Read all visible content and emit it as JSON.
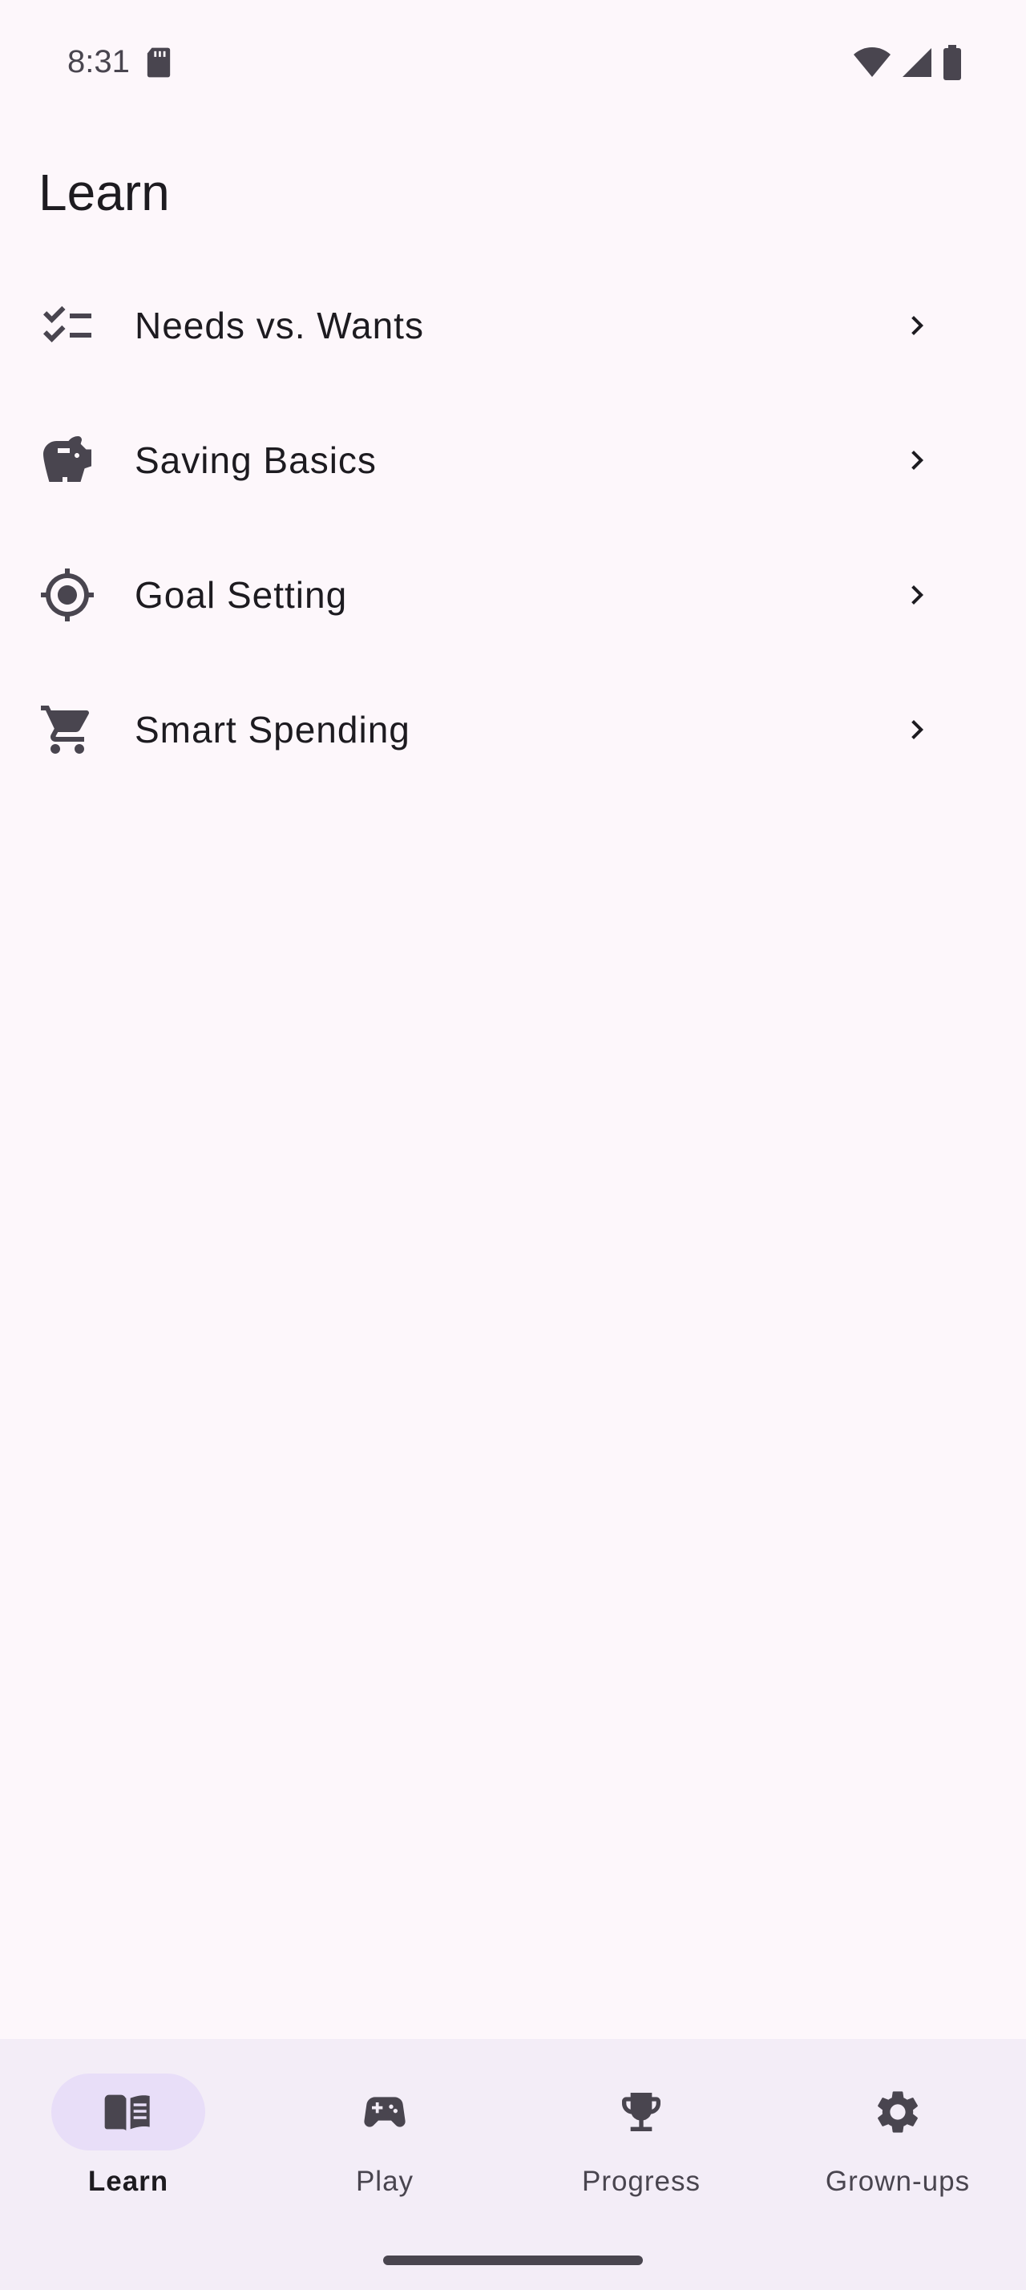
{
  "status_bar": {
    "time": "8:31",
    "icons": [
      "sd-card-icon",
      "wifi-icon",
      "signal-icon",
      "battery-icon"
    ]
  },
  "header": {
    "title": "Learn"
  },
  "topics": [
    {
      "label": "Needs vs. Wants",
      "icon": "checklist-icon"
    },
    {
      "label": "Saving Basics",
      "icon": "piggy-bank-icon"
    },
    {
      "label": "Goal Setting",
      "icon": "target-icon"
    },
    {
      "label": "Smart Spending",
      "icon": "shopping-cart-icon"
    }
  ],
  "bottom_nav": {
    "items": [
      {
        "label": "Learn",
        "icon": "book-icon",
        "active": true
      },
      {
        "label": "Play",
        "icon": "gamepad-icon",
        "active": false
      },
      {
        "label": "Progress",
        "icon": "trophy-icon",
        "active": false
      },
      {
        "label": "Grown-ups",
        "icon": "gear-icon",
        "active": false
      }
    ]
  },
  "colors": {
    "background": "#FDF7FB",
    "nav_background": "#F3EDF7",
    "active_indicator": "#E8DEF8",
    "icon": "#49454F",
    "text": "#1D1B20"
  }
}
